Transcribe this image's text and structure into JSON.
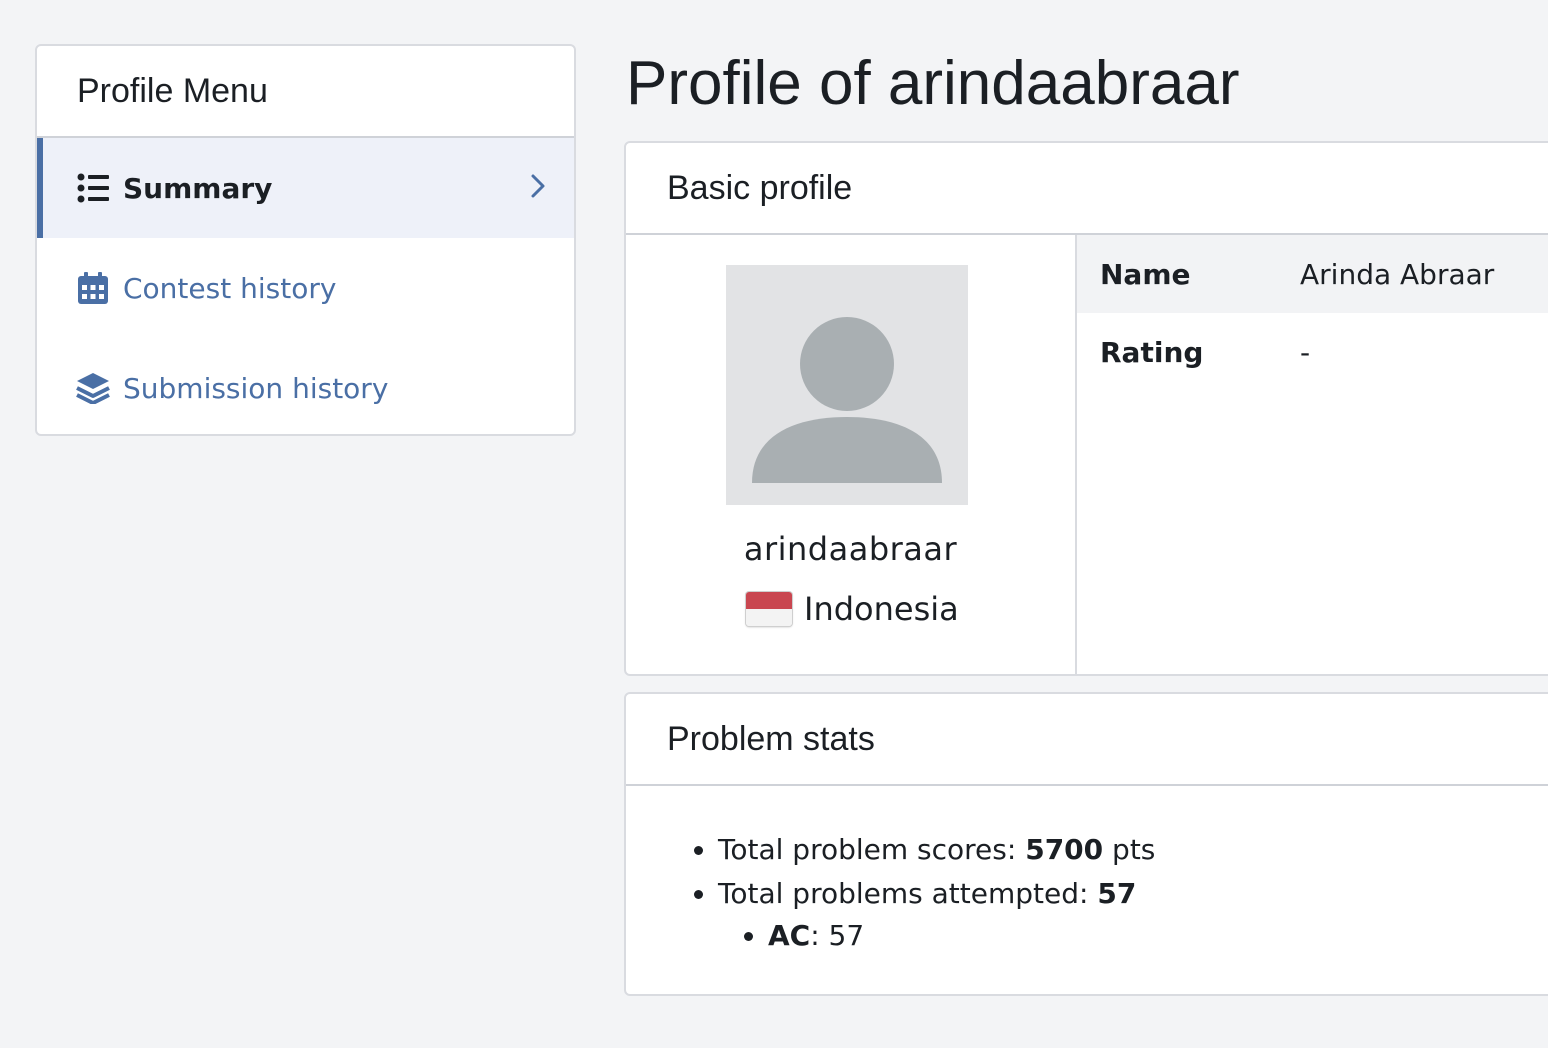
{
  "sidebar": {
    "title": "Profile Menu",
    "items": [
      {
        "label": "Summary",
        "icon": "list-icon",
        "active": true
      },
      {
        "label": "Contest history",
        "icon": "calendar-icon",
        "active": false
      },
      {
        "label": "Submission history",
        "icon": "layers-icon",
        "active": false
      }
    ]
  },
  "page": {
    "title": "Profile of arindaabraar"
  },
  "basic_profile": {
    "title": "Basic profile",
    "username": "arindaabraar",
    "country": "Indonesia",
    "fields": [
      {
        "label": "Name",
        "value": "Arinda Abraar"
      },
      {
        "label": "Rating",
        "value": "-"
      }
    ]
  },
  "problem_stats": {
    "title": "Problem stats",
    "scores_label": "Total problem scores: ",
    "scores_value": "5700",
    "scores_unit": " pts",
    "attempted_label": "Total problems attempted: ",
    "attempted_value": "57",
    "verdicts": [
      {
        "label": "AC",
        "value": ": 57"
      }
    ]
  },
  "colors": {
    "accent": "#4a6fa5",
    "background": "#f3f4f6",
    "active_item_bg": "#eef1f9",
    "flag_red": "#c94650",
    "avatar_bg": "#e2e3e5"
  }
}
